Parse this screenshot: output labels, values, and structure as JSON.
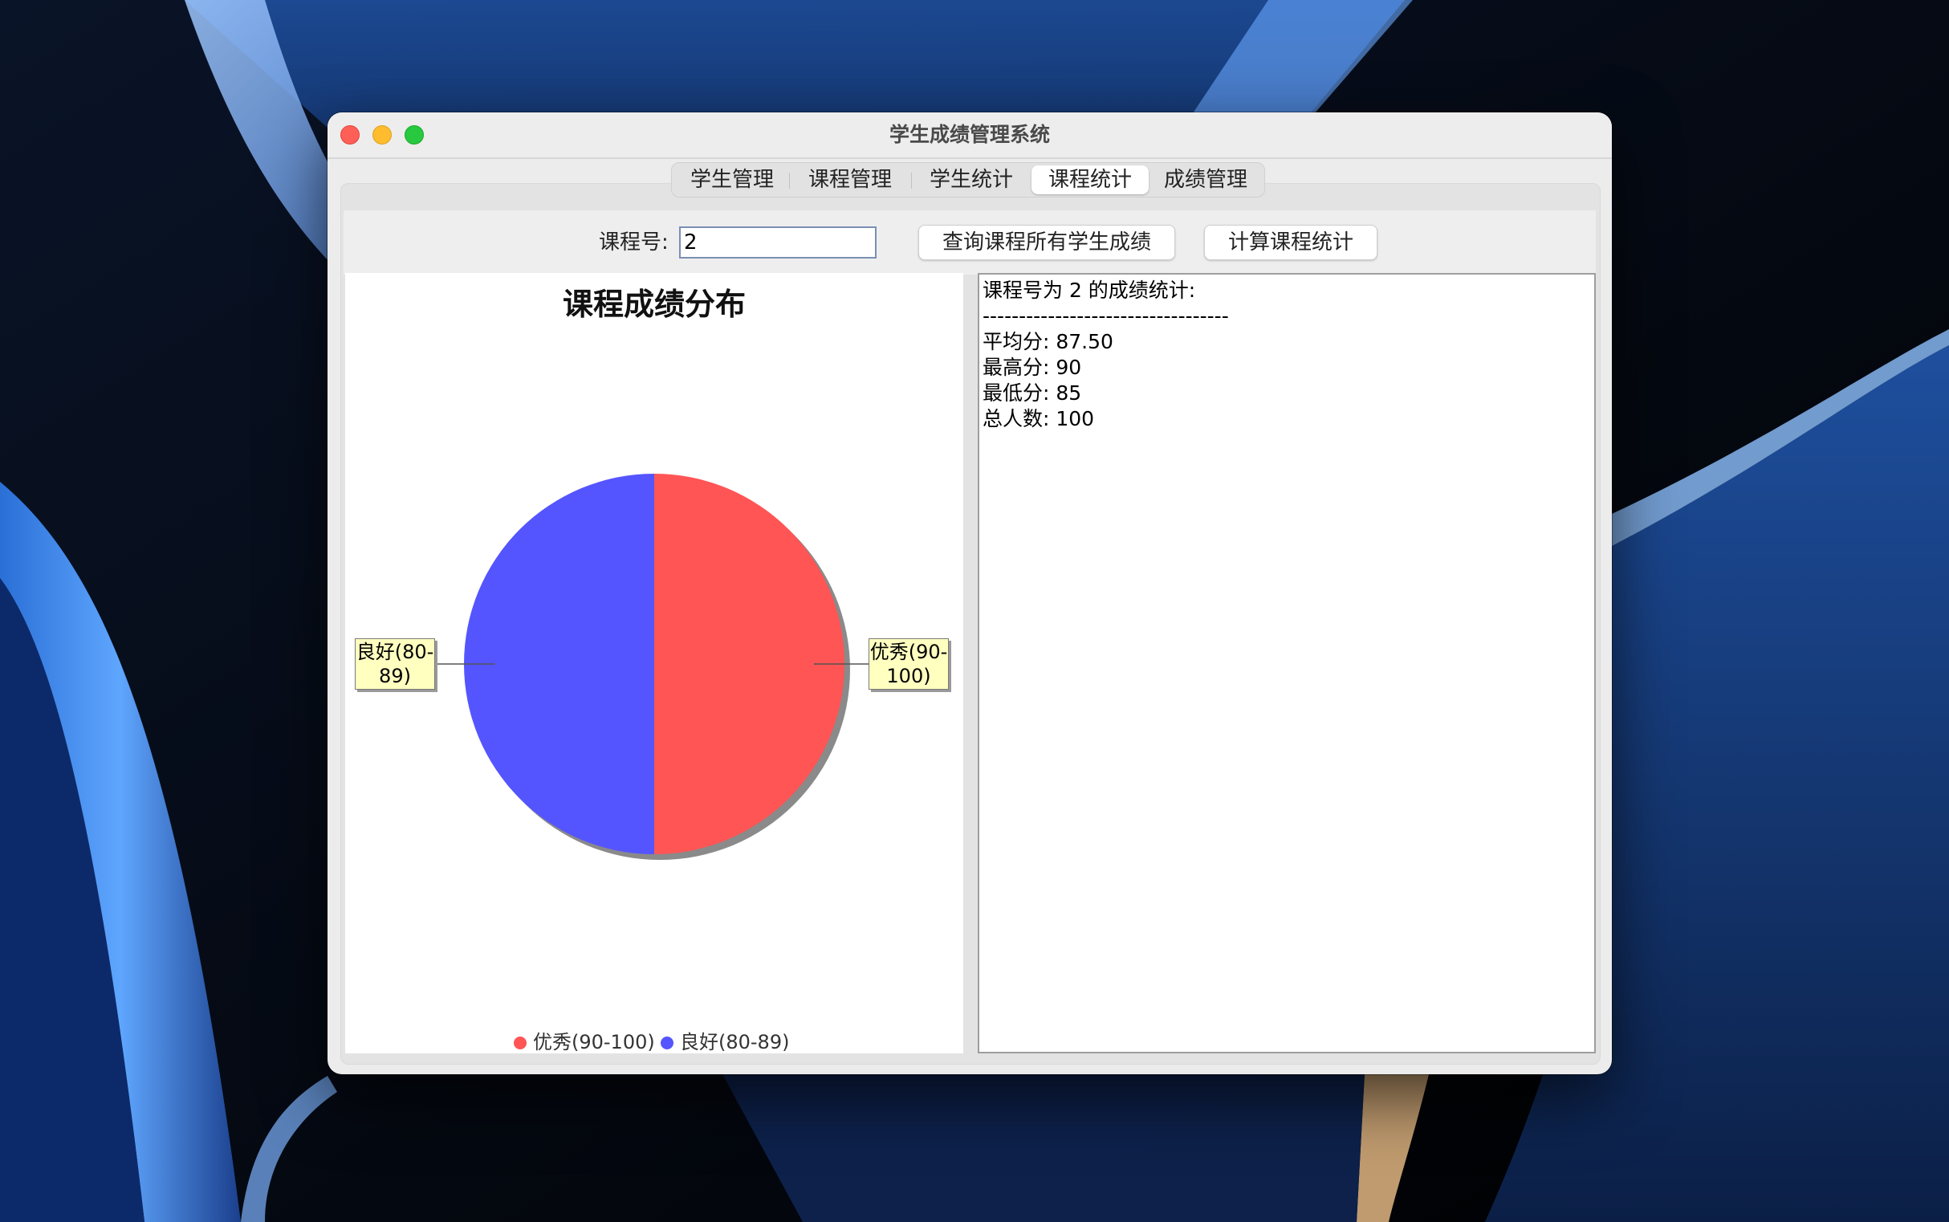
{
  "window": {
    "title": "学生成绩管理系统"
  },
  "tabs": [
    {
      "label": "学生管理"
    },
    {
      "label": "课程管理"
    },
    {
      "label": "学生统计"
    },
    {
      "label": "课程统计",
      "selected": true
    },
    {
      "label": "成绩管理"
    }
  ],
  "toolbar": {
    "course_label": "课程号:",
    "course_value": "2",
    "query_button": "查询课程所有学生成绩",
    "calc_button": "计算课程统计"
  },
  "stats": {
    "lines": [
      "课程号为 2 的成绩统计:",
      "----------------------------------",
      "平均分: 87.50",
      "最高分: 90",
      "最低分: 85",
      "总人数: 100"
    ]
  },
  "chart_data": {
    "type": "pie",
    "title": "课程成绩分布",
    "slices": [
      {
        "label": "优秀(90-100)",
        "value": 50,
        "color": "#ff5555",
        "callout": "优秀(90-\n100)"
      },
      {
        "label": "良好(80-89)",
        "value": 50,
        "color": "#5555ff",
        "callout": "良好(80-\n89)"
      }
    ],
    "legend_position": "bottom"
  }
}
